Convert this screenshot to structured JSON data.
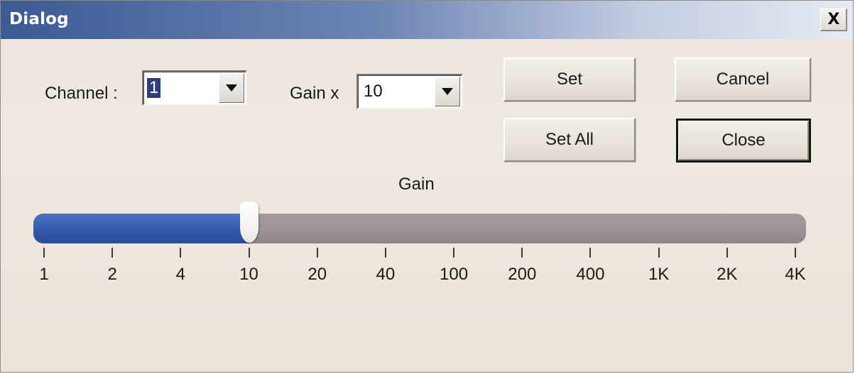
{
  "window": {
    "title": "Dialog",
    "close_glyph": "X",
    "close_icon": "close-icon"
  },
  "controls": {
    "channel_label": "Channel :",
    "channel_value": "1",
    "gain_label": "Gain x",
    "gain_value": "10"
  },
  "buttons": {
    "set": "Set",
    "cancel": "Cancel",
    "set_all": "Set All",
    "close": "Close"
  },
  "slider": {
    "title": "Gain",
    "ticks": [
      "1",
      "2",
      "4",
      "10",
      "20",
      "40",
      "100",
      "200",
      "400",
      "1K",
      "2K",
      "4K"
    ],
    "selected_tick": "10",
    "selected_index": 3,
    "fill_color": "#3359ad",
    "track_color": "#9a9296"
  }
}
